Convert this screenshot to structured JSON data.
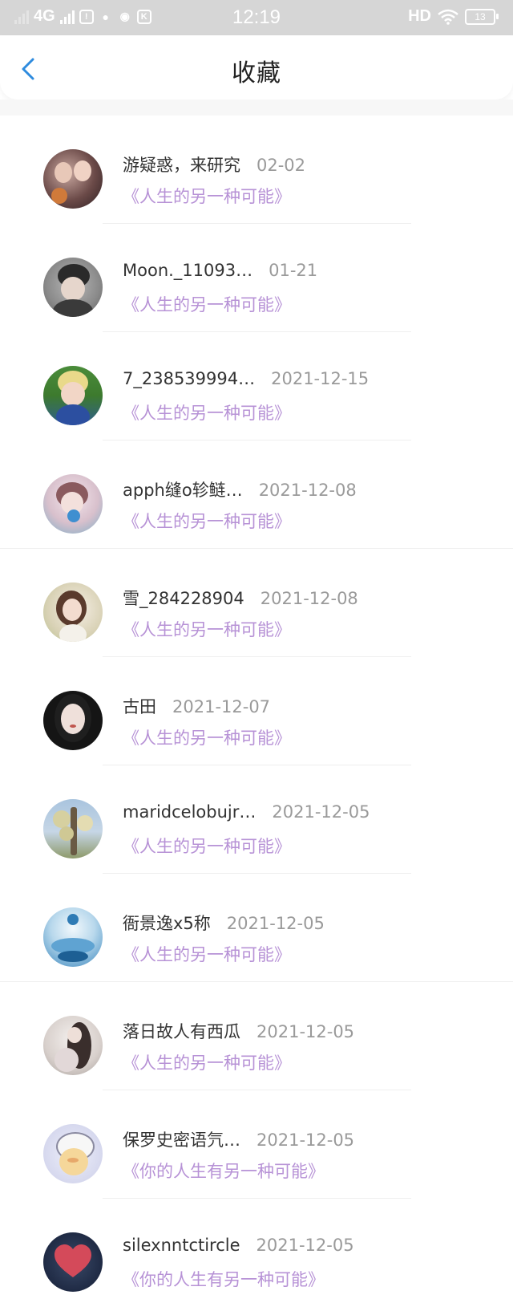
{
  "status_bar": {
    "network": "4G",
    "time": "12:19",
    "hd": "HD",
    "battery": "13"
  },
  "header": {
    "back_icon": "chevron-left-icon",
    "title": "收藏"
  },
  "colors": {
    "accent_blue": "#2e8bde",
    "work_title_purple": "#b792d6",
    "date_gray": "#9a9a9a"
  },
  "favorites": [
    {
      "username": "游疑惑，来研究",
      "date": "02-02",
      "work": "《人生的另一种可能》"
    },
    {
      "username": "Moon._11093…",
      "date": "01-21",
      "work": "《人生的另一种可能》"
    },
    {
      "username": "7_238539994…",
      "date": "2021-12-15",
      "work": "《人生的另一种可能》"
    },
    {
      "username": "apph缝o轸鲢…",
      "date": "2021-12-08",
      "work": "《人生的另一种可能》"
    },
    {
      "username": "雪_284228904",
      "date": "2021-12-08",
      "work": "《人生的另一种可能》"
    },
    {
      "username": "古田",
      "date": "2021-12-07",
      "work": "《人生的另一种可能》"
    },
    {
      "username": "maridcelobujr…",
      "date": "2021-12-05",
      "work": "《人生的另一种可能》"
    },
    {
      "username": "衙景逸x5称",
      "date": "2021-12-05",
      "work": "《人生的另一种可能》"
    },
    {
      "username": "落日故人有西瓜",
      "date": "2021-12-05",
      "work": "《人生的另一种可能》"
    },
    {
      "username": "保罗史密语氕…",
      "date": "2021-12-05",
      "work": "《你的人生有另一种可能》"
    },
    {
      "username": "silexnntctircle",
      "date": "2021-12-05",
      "work": "《你的人生有另一种可能》"
    }
  ]
}
